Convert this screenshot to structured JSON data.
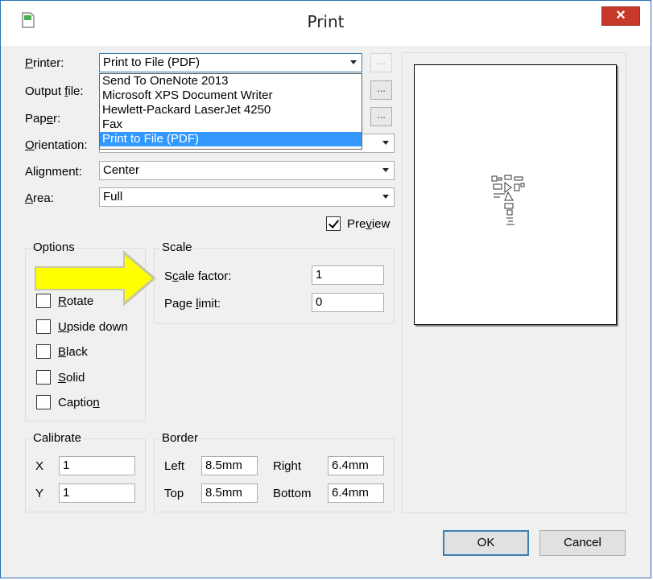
{
  "window": {
    "title": "Print",
    "close_label": "✕"
  },
  "printer": {
    "label_pre": "",
    "label_u": "P",
    "label_post": "rinter:",
    "selected": "Print to File (PDF)",
    "options": [
      "Send To OneNote 2013",
      "Microsoft XPS Document Writer",
      "Hewlett-Packard LaserJet 4250",
      "Fax",
      "Print to File (PDF)"
    ],
    "dots": "..."
  },
  "output_file": {
    "label_pre": "Output ",
    "label_u": "f",
    "label_post": "ile:",
    "dots": "..."
  },
  "paper": {
    "label_pre": "Pap",
    "label_u": "e",
    "label_post": "r:",
    "dots": "..."
  },
  "orientation": {
    "label_pre": "",
    "label_u": "O",
    "label_post": "rientation:"
  },
  "alignment": {
    "label_pre": "Ali",
    "label_u": "g",
    "label_post": "nment:",
    "value": "Center"
  },
  "area": {
    "label_pre": "",
    "label_u": "A",
    "label_post": "rea:",
    "value": "Full"
  },
  "preview": {
    "label_pre": "Pre",
    "label_u": "v",
    "label_post": "iew",
    "checked": true
  },
  "options_group": {
    "title": "Options",
    "items": [
      {
        "pre": "",
        "u": "R",
        "post": "otate"
      },
      {
        "pre": "",
        "u": "U",
        "post": "pside down"
      },
      {
        "pre": "",
        "u": "B",
        "post": "lack"
      },
      {
        "pre": "",
        "u": "S",
        "post": "olid"
      },
      {
        "pre": "Captio",
        "u": "n",
        "post": ""
      }
    ]
  },
  "scale_group": {
    "title": "Scale",
    "scale_factor": {
      "pre": "S",
      "u": "c",
      "post": "ale factor:",
      "value": "1"
    },
    "page_limit": {
      "pre": "Page ",
      "u": "l",
      "post": "imit:",
      "value": "0"
    }
  },
  "calibrate_group": {
    "title": "Calibrate",
    "x_label": "X",
    "x_value": "1",
    "y_label": "Y",
    "y_value": "1"
  },
  "border_group": {
    "title": "Border",
    "left_label": "Left",
    "left_value": "8.5mm",
    "right_label": "Right",
    "right_value": "6.4mm",
    "top_label": "Top",
    "top_value": "8.5mm",
    "bottom_label": "Bottom",
    "bottom_value": "6.4mm"
  },
  "buttons": {
    "ok": "OK",
    "cancel": "Cancel"
  },
  "colors": {
    "close": "#c7392b",
    "highlight": "#3399ff",
    "arrow": "#ffff00"
  }
}
